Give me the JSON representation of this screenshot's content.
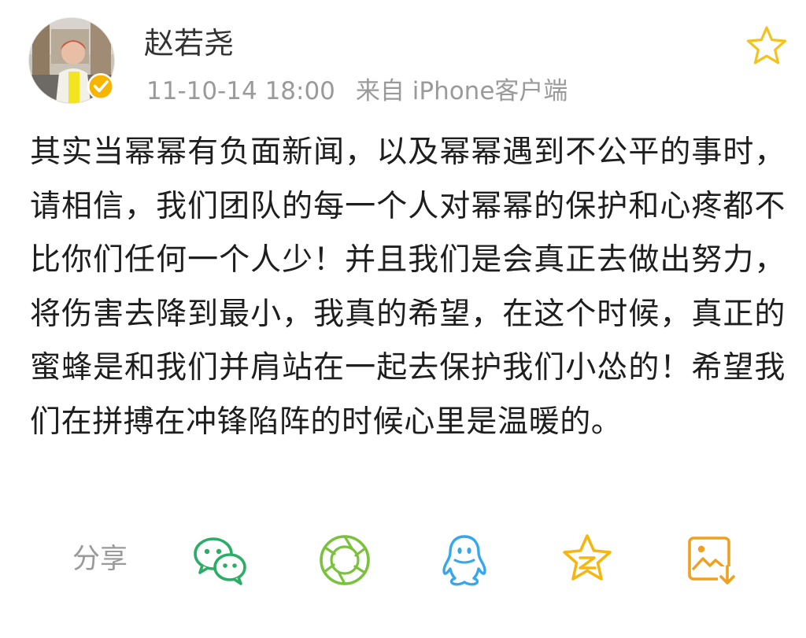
{
  "post": {
    "author": "赵若尧",
    "timestamp": "11-10-14 18:00",
    "source": "来自 iPhone客户端",
    "content": "其实当幂幂有负面新闻，以及幂幂遇到不公平的事时，请相信，我们团队的每一个人对幂幂的保护和心疼都不比你们任何一个人少！并且我们是会真正去做出努力，将伤害去降到最小，我真的希望，在这个时候，真正的蜜蜂是和我们并肩站在一起去保护我们小怂的！希望我们在拼搏在冲锋陷阵的时候心里是温暖的。",
    "favorite_icon": "star-outline-icon",
    "verified_icon": "verified-badge-icon"
  },
  "share": {
    "label": "分享",
    "targets": [
      {
        "name": "WeChat",
        "icon": "wechat-icon",
        "color": "#2aae67"
      },
      {
        "name": "Moments",
        "icon": "moments-icon",
        "color": "#7ac23c"
      },
      {
        "name": "QQ",
        "icon": "qq-icon",
        "color": "#35a7ec"
      },
      {
        "name": "QZone",
        "icon": "qzone-icon",
        "color": "#f5b70f"
      },
      {
        "name": "Save Image",
        "icon": "save-image-icon",
        "color": "#f0a020"
      }
    ]
  },
  "colors": {
    "meta_text": "#9a9a9a",
    "star_gold": "#f3c21c",
    "badge_yellow": "#f7b500"
  }
}
